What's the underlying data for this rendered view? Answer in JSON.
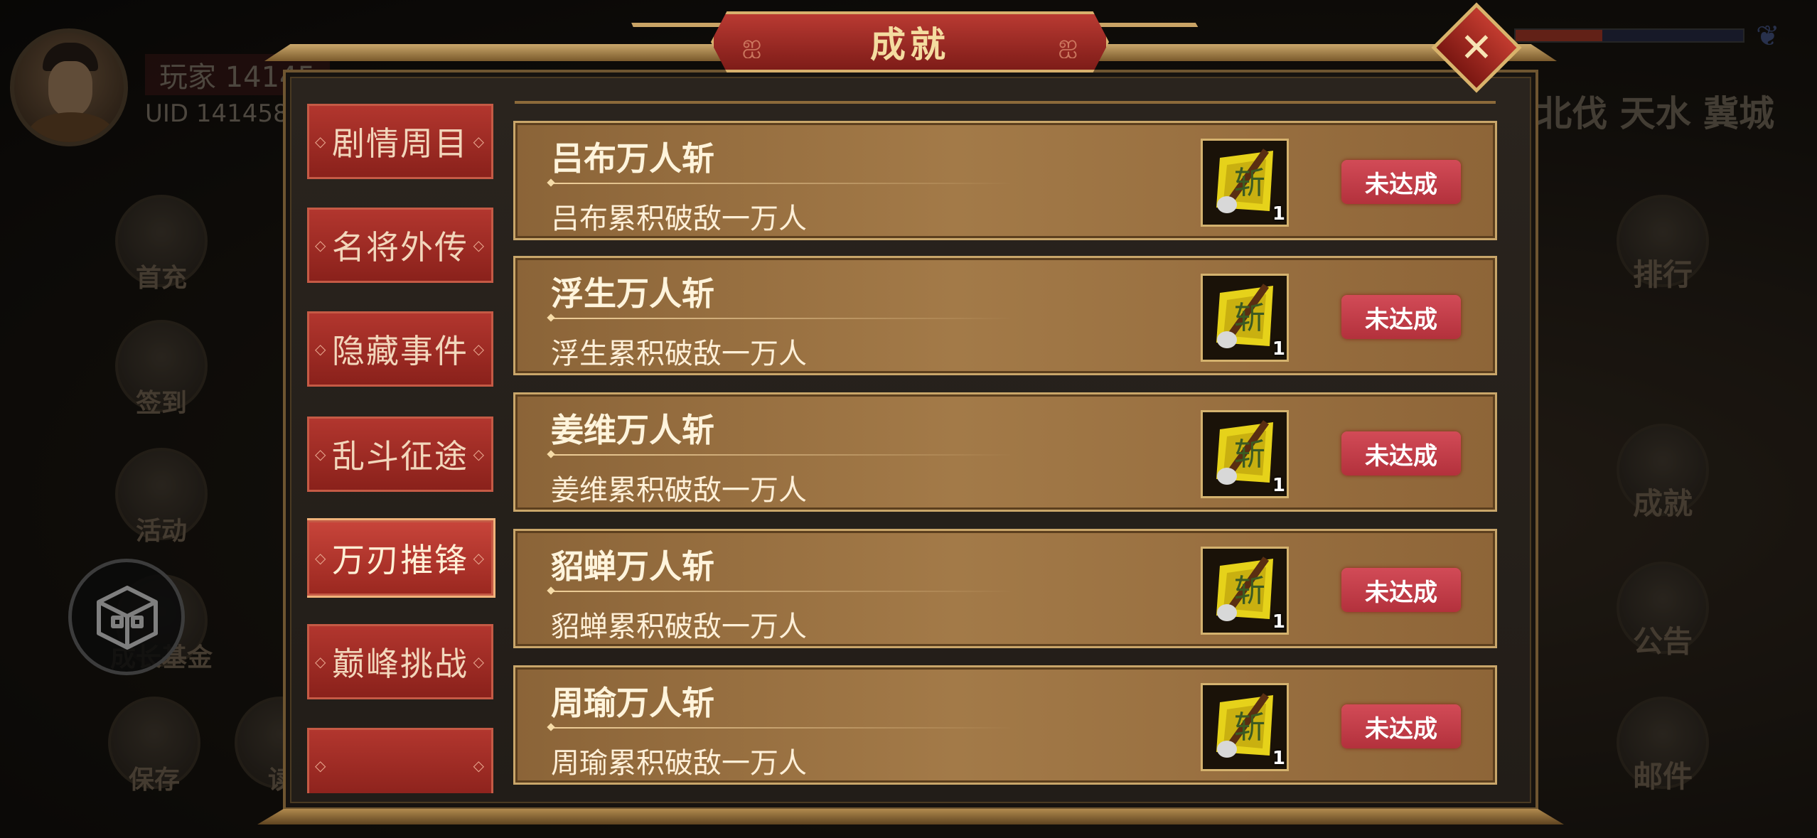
{
  "dialog": {
    "title": "成就",
    "close_label": "✕"
  },
  "tabs": [
    {
      "label": "剧情周目",
      "active": false
    },
    {
      "label": "名将外传",
      "active": false
    },
    {
      "label": "隐藏事件",
      "active": false
    },
    {
      "label": "乱斗征途",
      "active": false
    },
    {
      "label": "万刃摧锋",
      "active": true
    },
    {
      "label": "巅峰挑战",
      "active": false
    },
    {
      "label": "",
      "active": false
    }
  ],
  "achievements": [
    {
      "name": "吕布万人斩",
      "desc": "吕布累积破敌一万人",
      "reward_count": "1",
      "status": "未达成"
    },
    {
      "name": "浮生万人斩",
      "desc": "浮生累积破敌一万人",
      "reward_count": "1",
      "status": "未达成"
    },
    {
      "name": "姜维万人斩",
      "desc": "姜维累积破敌一万人",
      "reward_count": "1",
      "status": "未达成"
    },
    {
      "name": "貂蝉万人斩",
      "desc": "貂蝉累积破敌一万人",
      "reward_count": "1",
      "status": "未达成"
    },
    {
      "name": "周瑜万人斩",
      "desc": "周瑜累积破敌一万人",
      "reward_count": "1",
      "status": "未达成"
    }
  ],
  "background": {
    "player_name": "玩家 14145",
    "player_uid": "UID  141458",
    "cities": "北伐 天水   冀城",
    "left_buttons": [
      "首充",
      "签到",
      "活动",
      "成长基金",
      "保存",
      "读"
    ],
    "right_buttons": [
      "排行",
      "成就",
      "公告",
      "邮件"
    ]
  },
  "colors": {
    "tab_red": "#b2362e",
    "row_brown": "#a37a48",
    "gold_border": "#c9a66a",
    "status_red": "#c93f4a"
  }
}
